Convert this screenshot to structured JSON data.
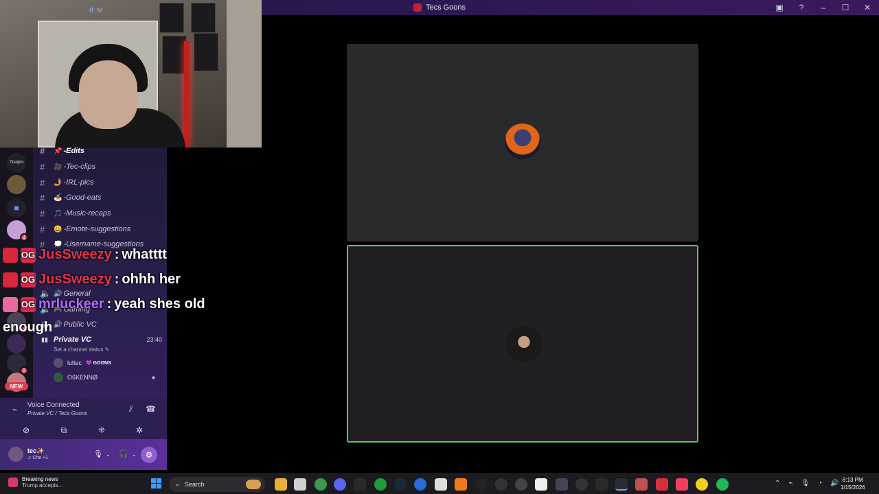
{
  "window": {
    "title": "Tecs Goons"
  },
  "webcam": {
    "tag": "8: M"
  },
  "servers": {
    "server1_label": "Tbatphi",
    "badge_a": "4",
    "badge_b": "4",
    "badge_c": "8",
    "new_label": "NEW"
  },
  "channels": [
    {
      "name": "-Edits",
      "emoji": "📌"
    },
    {
      "name": "-Tec-clips",
      "emoji": "🎥"
    },
    {
      "name": "-IRL-pics",
      "emoji": "🤳"
    },
    {
      "name": "-Good-eats",
      "emoji": "🍝"
    },
    {
      "name": "-Music-recaps",
      "emoji": "🎵"
    },
    {
      "name": "-Emote-suggestions",
      "emoji": "😀"
    },
    {
      "name": "-Username-suggestions",
      "emoji": "💭"
    }
  ],
  "voice_channels": [
    {
      "name": "General",
      "emoji": "🔊"
    },
    {
      "name": "Gaming",
      "emoji": "🎮"
    },
    {
      "name": "Public VC",
      "emoji": "🔊"
    }
  ],
  "private_vc": {
    "name": "Private VC",
    "time": "23:40",
    "status": "Set a channel status ✎",
    "users": [
      {
        "name": "lultec",
        "tag": "💜 GOONS"
      },
      {
        "name": "O6KENNØ",
        "tag": ""
      }
    ]
  },
  "voice": {
    "title": "Voice Connected",
    "subtitle": "Private VC / Tecs Goons"
  },
  "user": {
    "name": "tec✨",
    "status": "♫ Che +1"
  },
  "chat": [
    {
      "nick": "JusSweezy",
      "message": "whatttt",
      "color": "#e8334a"
    },
    {
      "nick": "JusSweezy",
      "message": "ohhh her",
      "color": "#e8334a"
    },
    {
      "nick": "mrluckeer",
      "message": "yeah shes old",
      "color": "#b26aff"
    }
  ],
  "chat_wrap": "enough",
  "taskbar": {
    "news_title": "Breaking news",
    "news_sub": "Trump accepts...",
    "search_placeholder": "Search",
    "time": "8:13 PM",
    "date": "1/15/2026"
  },
  "colors": {
    "speaking_border": "#4ecf5c",
    "accent": "#8c5fd0"
  }
}
